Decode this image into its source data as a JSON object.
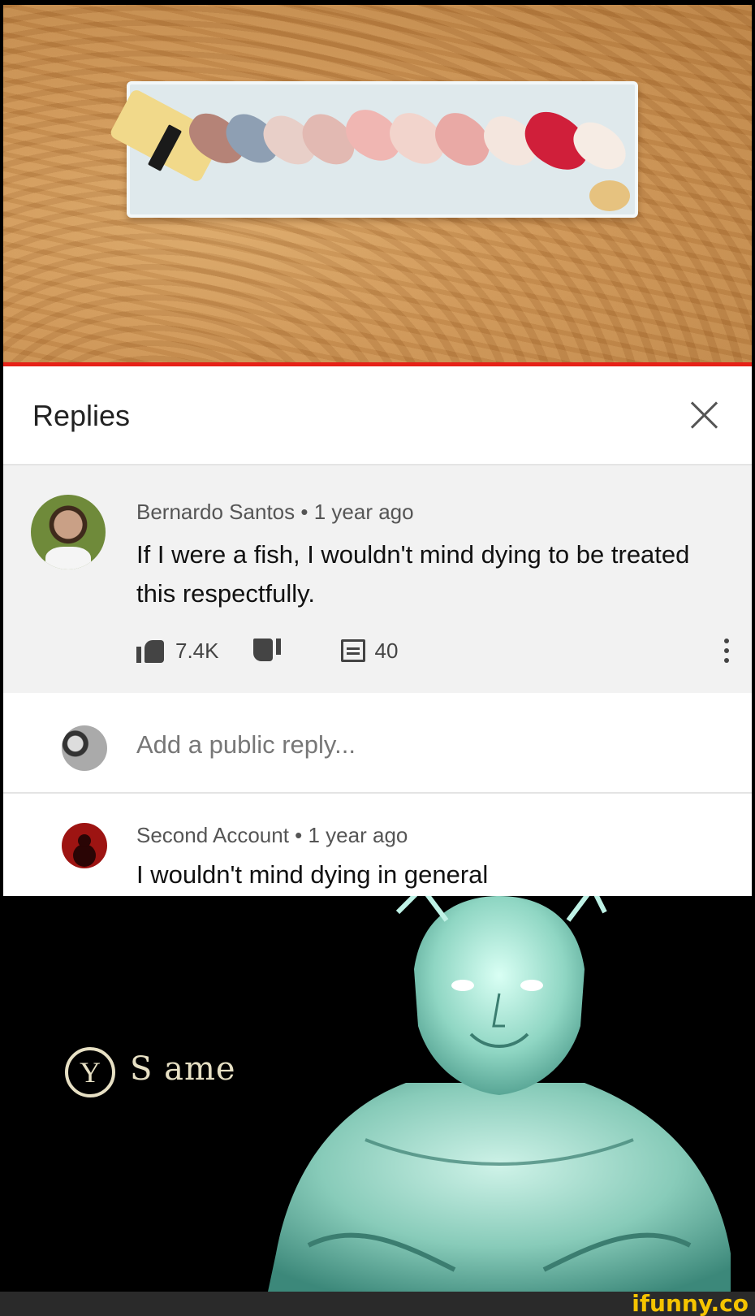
{
  "video": {
    "scene": "sushi-plate",
    "progress_color": "#e62117"
  },
  "replies_panel": {
    "title": "Replies",
    "close_icon": "close-icon"
  },
  "main_comment": {
    "author": "Bernardo Santos",
    "time": "1 year ago",
    "separator": "•",
    "text": "If I were a fish, I wouldn't mind dying to be treated this respectfully.",
    "likes": "7.4K",
    "replies": "40",
    "icons": [
      "thumbs-up-icon",
      "thumbs-down-icon",
      "reply-icon",
      "more-vert-icon"
    ]
  },
  "add_reply": {
    "placeholder": "Add a public reply..."
  },
  "reply_comment": {
    "author": "Second Account",
    "time": "1 year ago",
    "separator": "•",
    "text": "I wouldn't mind dying in general"
  },
  "meme": {
    "button_glyph": "Y",
    "prompt_text": "S ame",
    "text_color": "#e7e0c4"
  },
  "watermark": {
    "text": "ifunny.co",
    "color": "#f5c400"
  }
}
